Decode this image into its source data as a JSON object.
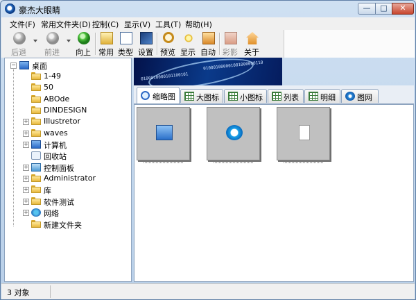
{
  "window": {
    "title": "豪杰大眼睛"
  },
  "menubar": {
    "items": [
      "文件(F)",
      "常用文件夹(D)",
      "控制(C)",
      "显示(V)",
      "工具(T)",
      "帮助(H)"
    ]
  },
  "toolbar": {
    "back": "后退",
    "forward": "前进",
    "up": "向上",
    "common": "常用",
    "type": "类型",
    "settings": "设置",
    "preview": "预览",
    "display": "显示",
    "auto": "自动",
    "color": "彩影",
    "about": "关于"
  },
  "tree": {
    "root": "桌面",
    "items": [
      "1-49",
      "50",
      "ABOde",
      "DINDESIGN",
      "Illustretor",
      "waves",
      "计算机",
      "回收站",
      "控制面板",
      "Administrator",
      "库",
      "软件测试",
      "网络",
      "新建文件夹"
    ]
  },
  "banner": {
    "digits1": "0100010000101100101",
    "digits2": "010001000001001000000110"
  },
  "tabs": [
    "缩略图",
    "大图标",
    "小图标",
    "列表",
    "明细",
    "图网"
  ],
  "thumbnails": [
    {
      "icon": "monitor-icon"
    },
    {
      "icon": "qq-cloud-icon"
    },
    {
      "icon": "document-icon"
    }
  ],
  "status": {
    "text": "3 对象"
  }
}
